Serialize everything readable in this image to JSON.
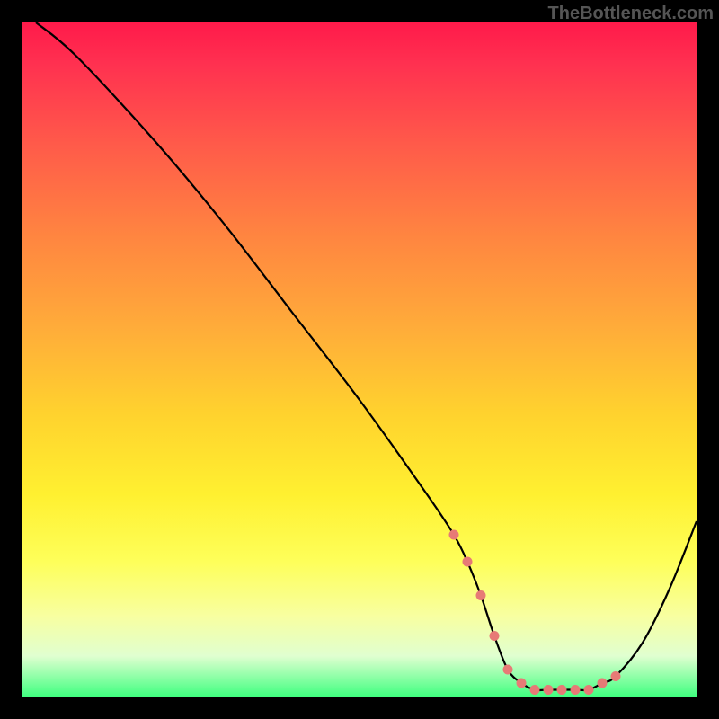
{
  "watermark": "TheBottleneck.com",
  "chart_data": {
    "type": "line",
    "title": "",
    "xlabel": "",
    "ylabel": "",
    "xlim": [
      0,
      100
    ],
    "ylim": [
      0,
      100
    ],
    "grid": false,
    "series": [
      {
        "name": "bottleneck-curve",
        "x": [
          2,
          8,
          20,
          30,
          40,
          50,
          60,
          64,
          66,
          68,
          70,
          72,
          74,
          76,
          78,
          80,
          82,
          84,
          86,
          88,
          92,
          96,
          100
        ],
        "y": [
          100,
          95,
          82,
          70,
          57,
          44,
          30,
          24,
          20,
          15,
          9,
          4,
          2,
          1,
          1,
          1,
          1,
          1,
          2,
          3,
          8,
          16,
          26
        ]
      }
    ],
    "markers": {
      "name": "dotted-bottom-segment",
      "color": "#e77a76",
      "x": [
        64,
        66,
        68,
        70,
        72,
        74,
        76,
        78,
        80,
        82,
        84,
        86,
        88
      ],
      "y": [
        24,
        20,
        15,
        9,
        4,
        2,
        1,
        1,
        1,
        1,
        1,
        2,
        3
      ]
    },
    "background_gradient": {
      "top": "#ff1a4a",
      "mid_upper": "#ff8640",
      "mid": "#ffd22e",
      "mid_lower": "#feff5a",
      "bottom": "#40ff80"
    }
  }
}
